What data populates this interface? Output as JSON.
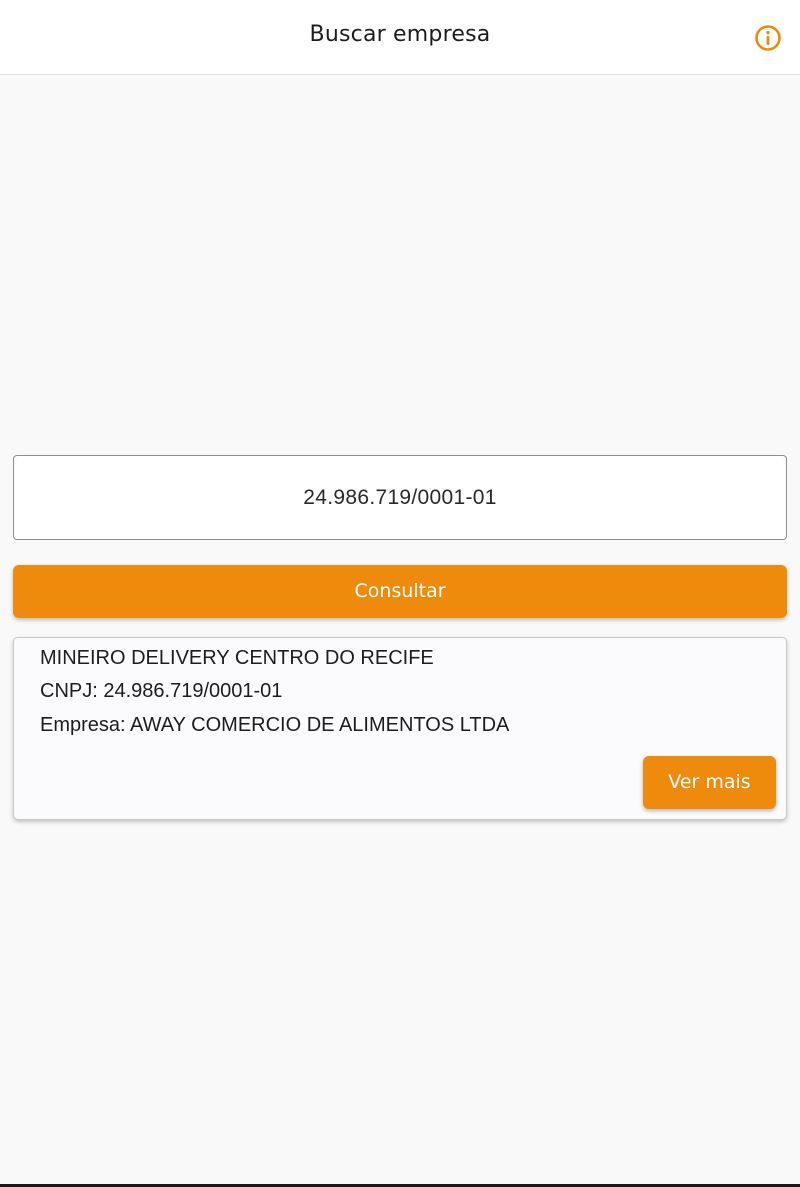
{
  "app_bar": {
    "title": "Buscar empresa",
    "info_icon": "info-circle-icon",
    "accent_color": "#ee8a0c"
  },
  "search": {
    "value": "24.986.719/0001-01"
  },
  "consult_button": {
    "label": "Consultar",
    "color": "#ee8a0c"
  },
  "result": {
    "name": "MINEIRO DELIVERY CENTRO DO RECIFE",
    "cnpj_line": "CNPJ: 24.986.719/0001-01",
    "company_line": "Empresa: AWAY COMERCIO DE ALIMENTOS LTDA",
    "more_label": "Ver mais"
  }
}
